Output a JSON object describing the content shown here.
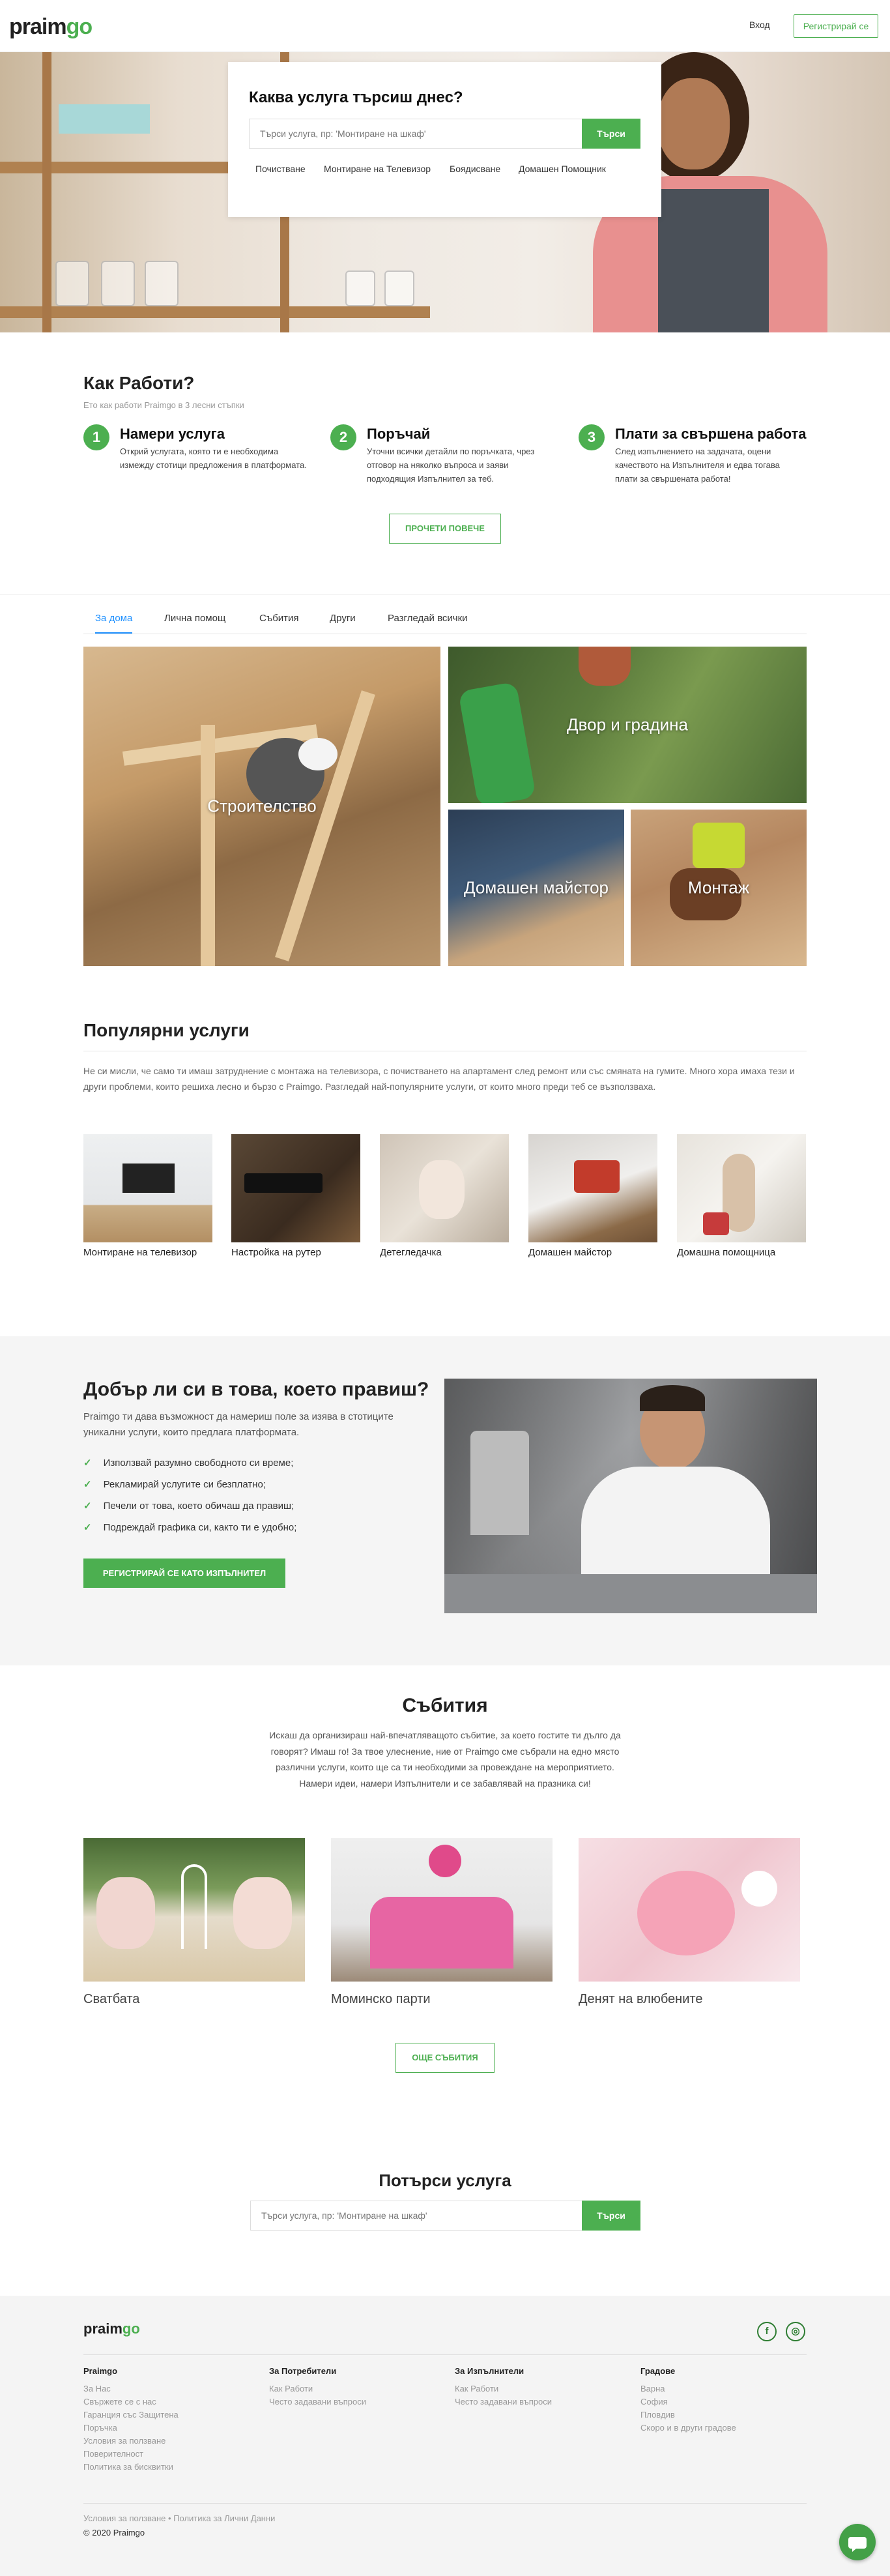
{
  "header": {
    "logo_main": "praim",
    "logo_go": "go",
    "login": "Вход",
    "register": "Регистрирай се"
  },
  "hero": {
    "question": "Каква услуга търсиш днес?",
    "placeholder": "Търси услуга, пр: 'Монтиране на шкаф'",
    "search_btn": "Търси",
    "quick_links": [
      "Почистване",
      "Монтиране на Телевизор",
      "Боядисване",
      "Домашен Помощник"
    ]
  },
  "how": {
    "title": "Как Работи?",
    "subtitle": "Ето как работи Praimgo в 3 лесни стъпки",
    "steps": [
      {
        "num": "1",
        "title": "Намери услуга",
        "desc": "Открий услугата, която ти е необходима измежду стотици предложения в платформата."
      },
      {
        "num": "2",
        "title": "Поръчай",
        "desc": "Уточни всички детайли по поръчката, чрез отговор на няколко въпроса и заяви подходящия Изпълнител за теб."
      },
      {
        "num": "3",
        "title": "Плати за свършена работа",
        "desc": "След изпълнението на задачата, оцени качеството на Изпълнителя и едва тогава плати за свършената работа!"
      }
    ],
    "read_more": "ПРОЧЕТИ ПОВЕЧЕ"
  },
  "tabs": [
    "За дома",
    "Лична помощ",
    "Събития",
    "Други",
    "Разгледай всички"
  ],
  "tiles": {
    "construction": "Строителство",
    "garden": "Двор и градина",
    "handyman": "Домашен майстор",
    "assembly": "Монтаж"
  },
  "popular": {
    "title": "Популярни услуги",
    "desc": "Не си мисли, че само ти имаш затруднение с монтажа на телевизора, с почистването на апартамент след ремонт или със смяната на гумите. Много хора имаха тези и други проблеми, които решиха лесно и бързо с Praimgo. Разгледай най-популярните услуги, от които много преди теб се възползваха.",
    "items": [
      "Монтиране на телевизор",
      "Настройка на рутер",
      "Детегледачка",
      "Домашен майстор",
      "Домашна помощница"
    ]
  },
  "pro": {
    "title": "Добър ли си в това, което правиш?",
    "desc": "Praimgo ти дава възможност да намериш поле за изява в стотиците уникални услуги, които предлага платформата.",
    "checks": [
      "Използвай разумно свободното си време;",
      "Рекламирай услугите си безплатно;",
      "Печели от това, което обичаш да правиш;",
      "Подреждай графика си, както ти е удобно;"
    ],
    "button": "РЕГИСТРИРАЙ СЕ КАТО ИЗПЪЛНИТЕЛ"
  },
  "events": {
    "title": "Събития",
    "desc": "Искаш да организираш най-впечатляващото събитие, за което гостите ти дълго да говорят? Имаш го! За твое улеснение, ние от Praimgo сме събрали на едно място различни услуги, които ще са ти необходими за провеждане на мероприятието. Намери идеи, намери Изпълнители и се забавлявай на празника си!",
    "items": [
      "Сватбата",
      "Моминско парти",
      "Денят на влюбените"
    ],
    "more": "ОЩЕ СЪБИТИЯ"
  },
  "search2": {
    "title": "Потърси услуга",
    "placeholder": "Търси услуга, пр: 'Монтиране на шкаф'",
    "button": "Търси"
  },
  "footer": {
    "logo_main": "praim",
    "logo_go": "go",
    "cols": [
      {
        "head": "Praimgo",
        "links": [
          "За Нас",
          "Свържете се с нас",
          "Гаранция със Защитена",
          "Поръчка",
          "Условия за ползване",
          "Поверителност",
          "Политика за бисквитки"
        ]
      },
      {
        "head": "За Потребители",
        "links": [
          "Как Работи",
          "Често задавани въпроси"
        ]
      },
      {
        "head": "За Изпълнители",
        "links": [
          "Как Работи",
          "Често задавани въпроси"
        ]
      },
      {
        "head": "Градове",
        "links": [
          "Варна",
          "София",
          "Пловдив",
          "Скоро и в други градове"
        ]
      }
    ],
    "legal": "Условия за ползване • Политика за Лични Данни",
    "copyright": "© 2020 Praimgo",
    "social": [
      "f",
      "◎"
    ]
  },
  "colors": {
    "accent": "#4caf50",
    "tab_active": "#1e90ff"
  }
}
